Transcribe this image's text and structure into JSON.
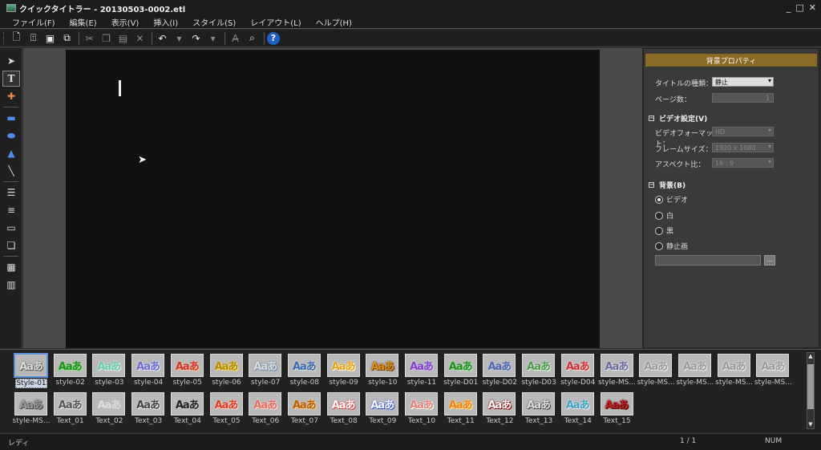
{
  "window": {
    "title": "クイックタイトラー - 20130503-0002.etl",
    "controls": [
      "_",
      "□",
      "✕"
    ]
  },
  "menu": [
    "ファイル(F)",
    "編集(E)",
    "表示(V)",
    "挿入(I)",
    "スタイル(S)",
    "レイアウト(L)",
    "ヘルプ(H)"
  ],
  "toolbar": {
    "icons": [
      "new-icon",
      "open-icon",
      "save-icon",
      "save-as-icon",
      "cut-icon",
      "copy-icon",
      "paste-icon",
      "delete-icon",
      "undo-icon",
      "redo-icon",
      "text-style-icon",
      "text-search-icon",
      "help-icon"
    ],
    "help_label": "?"
  },
  "left_tools": [
    "select-icon",
    "text-icon",
    "crosshair-icon",
    "rectangle-icon",
    "ellipse-icon",
    "triangle-icon",
    "line-icon",
    "align-left-icon",
    "align-center-icon",
    "align-right-icon",
    "layer-icon",
    "grid-icon",
    "table-icon"
  ],
  "props": {
    "header": "背景プロパティ",
    "title_type_label": "タイトルの種類：",
    "title_type_value": "静止",
    "page_count_label": "ページ数：",
    "page_count_value": "1",
    "video_section": "ビデオ設定(V)",
    "video_format_label": "ビデオフォーマット：",
    "video_format_value": "HD",
    "frame_size_label": "フレームサイズ：",
    "frame_size_value": "1920 x 1080",
    "aspect_label": "アスペクト比：",
    "aspect_value": "16 : 9",
    "bg_section": "背景(B)",
    "bg_options": [
      "ビデオ",
      "白",
      "黒",
      "静止画"
    ],
    "bg_selected": 0,
    "browse_label": "..."
  },
  "styles": {
    "sample_text": "Aaあ",
    "selected": 0,
    "row1": [
      "Style-01",
      "style-02",
      "style-03",
      "style-04",
      "style-05",
      "style-06",
      "style-07",
      "style-08",
      "style-09",
      "style-10",
      "style-11",
      "style-D01",
      "style-D02",
      "style-D03",
      "style-D04",
      "style-MS...",
      "style-MS...",
      "style-MS...",
      "style-MS...",
      "style-MS..."
    ],
    "row2": [
      "style-MS...",
      "Text_01",
      "Text_02",
      "Text_03",
      "Text_04",
      "Text_05",
      "Text_06",
      "Text_07",
      "Text_08",
      "Text_09",
      "Text_10",
      "Text_11",
      "Text_12",
      "Text_13",
      "Text_14",
      "Text_15"
    ]
  },
  "status": {
    "ready": "レディ",
    "page": "1 / 1",
    "num": "NUM"
  }
}
